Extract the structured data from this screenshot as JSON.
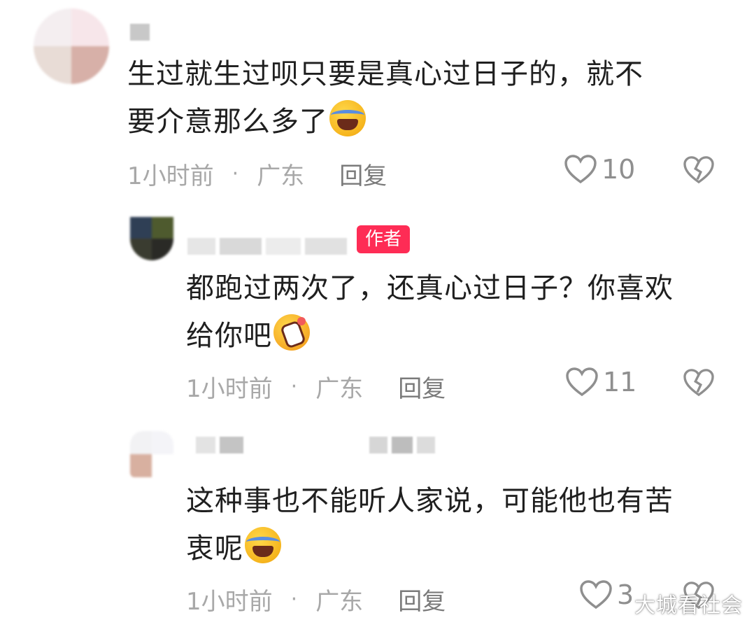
{
  "comments": [
    {
      "text_line1": "生过就生过呗只要是真心过日子的，就不",
      "text_line2": "要介意那么多了",
      "time": "1小时前",
      "sep": "·",
      "location": "广东",
      "reply_label": "回复",
      "likes": "10",
      "emoji": "face-tears-of-joy"
    },
    {
      "author_badge": "作者",
      "text_line1": "都跑过两次了，还真心过日子？你喜欢",
      "text_line2": "给你吧",
      "time": "1小时前",
      "sep": "·",
      "location": "广东",
      "reply_label": "回复",
      "likes": "11",
      "emoji": "face-with-bottle"
    },
    {
      "text_line1": "这种事也不能听人家说，可能他也有苦",
      "text_line2": "衷呢",
      "time": "1小时前",
      "sep": "·",
      "location": "广东",
      "reply_label": "回复",
      "likes": "3",
      "emoji": "face-tears-of-joy"
    }
  ],
  "watermark": "大城看社会",
  "colors": {
    "badge": "#fe2c55",
    "meta": "#a8a8a8",
    "text": "#1f1f1f"
  }
}
